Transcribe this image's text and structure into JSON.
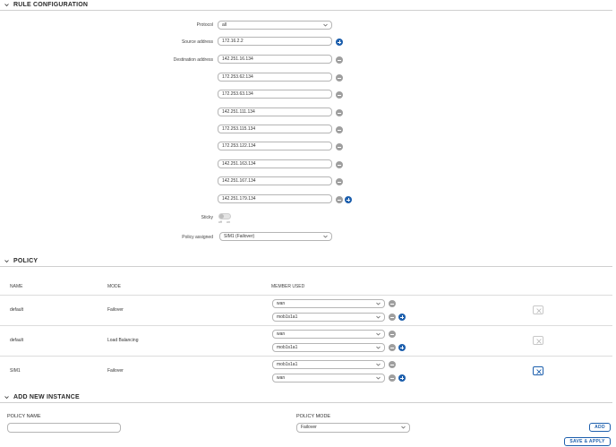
{
  "rule_config": {
    "section_title": "RULE CONFIGURATION",
    "protocol": {
      "label": "Protocol",
      "value": "all"
    },
    "source_address": {
      "label": "Source address",
      "value": "172.16.2.2"
    },
    "destination_address": {
      "label": "Destination address",
      "values": [
        "142.251.16.134",
        "172.253.62.134",
        "172.253.63.134",
        "142.251.111.134",
        "172.253.115.134",
        "172.253.122.134",
        "142.251.163.134",
        "142.251.167.134",
        "142.251.179.134"
      ]
    },
    "sticky": {
      "label": "Sticky",
      "off_label": "off",
      "on_label": "on",
      "state": "off"
    },
    "policy_assigned": {
      "label": "Policy assigned",
      "value": "SIM1 (Failover)"
    }
  },
  "policy": {
    "section_title": "POLICY",
    "columns": {
      "name": "NAME",
      "mode": "MODE",
      "member_used": "MEMBER USED"
    },
    "rows": [
      {
        "name": "default",
        "mode": "Failover",
        "members": [
          "wan",
          "mob1s1a1"
        ]
      },
      {
        "name": "default",
        "mode": "Load Balancing",
        "members": [
          "wan",
          "mob1s1a1"
        ]
      },
      {
        "name": "SIM1",
        "mode": "Failover",
        "members": [
          "mob1s1a1",
          "wan"
        ]
      }
    ]
  },
  "add_instance": {
    "section_title": "ADD NEW INSTANCE",
    "policy_name_label": "POLICY NAME",
    "policy_name_value": "",
    "policy_mode_label": "POLICY MODE",
    "policy_mode_value": "Failover",
    "add_button": "ADD",
    "save_apply_button": "SAVE & APPLY"
  },
  "colors": {
    "accent": "#1d5fad",
    "remove": "#9e9e9e",
    "border": "#b5b5b5"
  }
}
